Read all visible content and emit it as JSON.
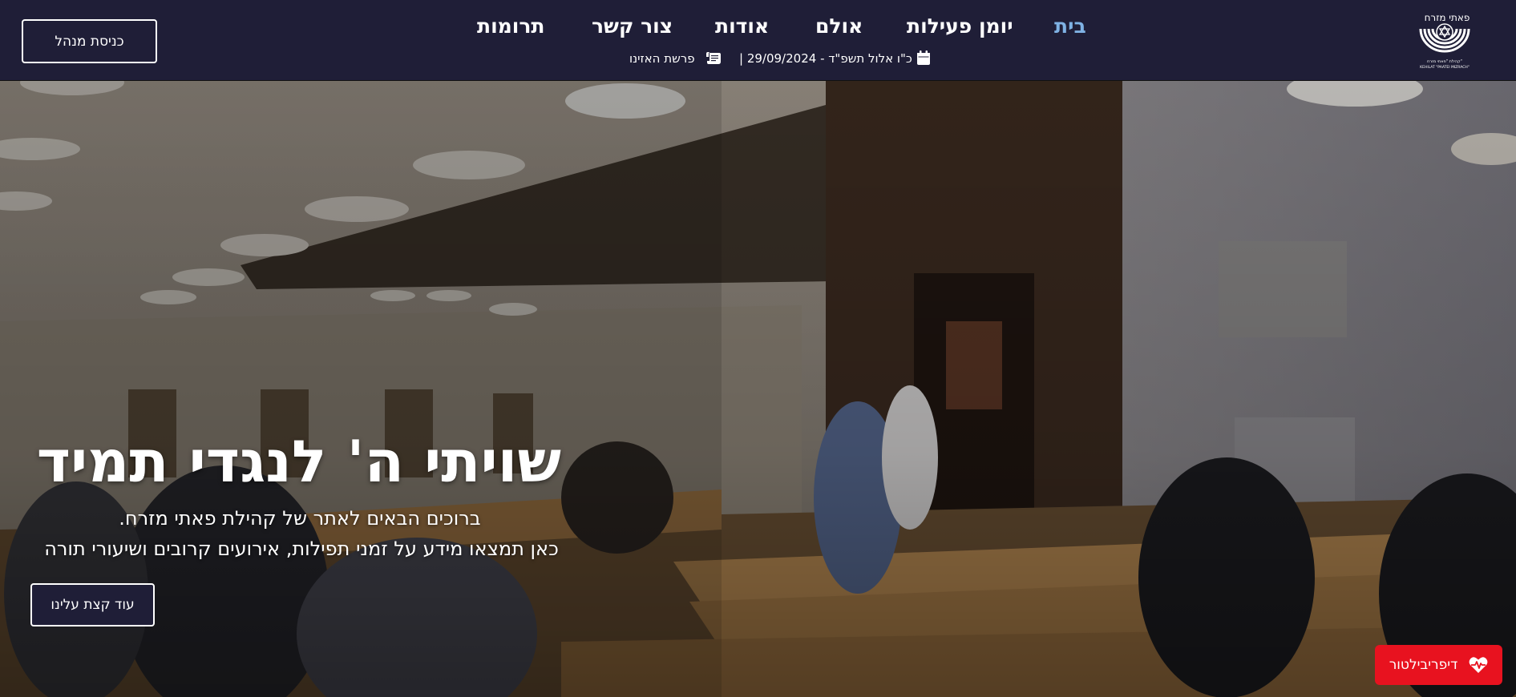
{
  "header": {
    "admin_button": "כניסת מנהל",
    "nav": [
      {
        "label": "בית",
        "active": true
      },
      {
        "label": "יומן פעילות",
        "active": false
      },
      {
        "label": "אולם",
        "active": false
      },
      {
        "label": "אודות",
        "active": false
      },
      {
        "label": "צור קשר",
        "active": false
      },
      {
        "label": "תרומות",
        "active": false
      }
    ],
    "date_text": "כ\"ו אלול תשפ\"ד - 29/09/2024 |",
    "parasha_text": "פרשת האזינו",
    "calendar_icon": "calendar-icon",
    "scroll_icon": "torah-scroll-icon",
    "logo": {
      "text_top": "פאתי מזרח",
      "text_bottom_he": "קהילת \"פאתי מזרח\"",
      "text_bottom_en": "KEHILAT \"PAATEI MIZRACH\""
    }
  },
  "hero": {
    "title": "שויתי ה' לנגדי תמיד",
    "line1": "ברוכים הבאים לאתר של קהילת פאתי מזרח.",
    "line2": "כאן תמצאו מידע על זמני תפילות, אירועים קרובים ושיעורי תורה",
    "about_button": "עוד קצת עלינו",
    "defib_button": "דיפריבילטור",
    "defib_icon": "heartbeat-icon"
  },
  "colors": {
    "header_bg": "#1f1e37",
    "nav_active": "#7fb2e4",
    "defib_red": "#e8121f"
  }
}
